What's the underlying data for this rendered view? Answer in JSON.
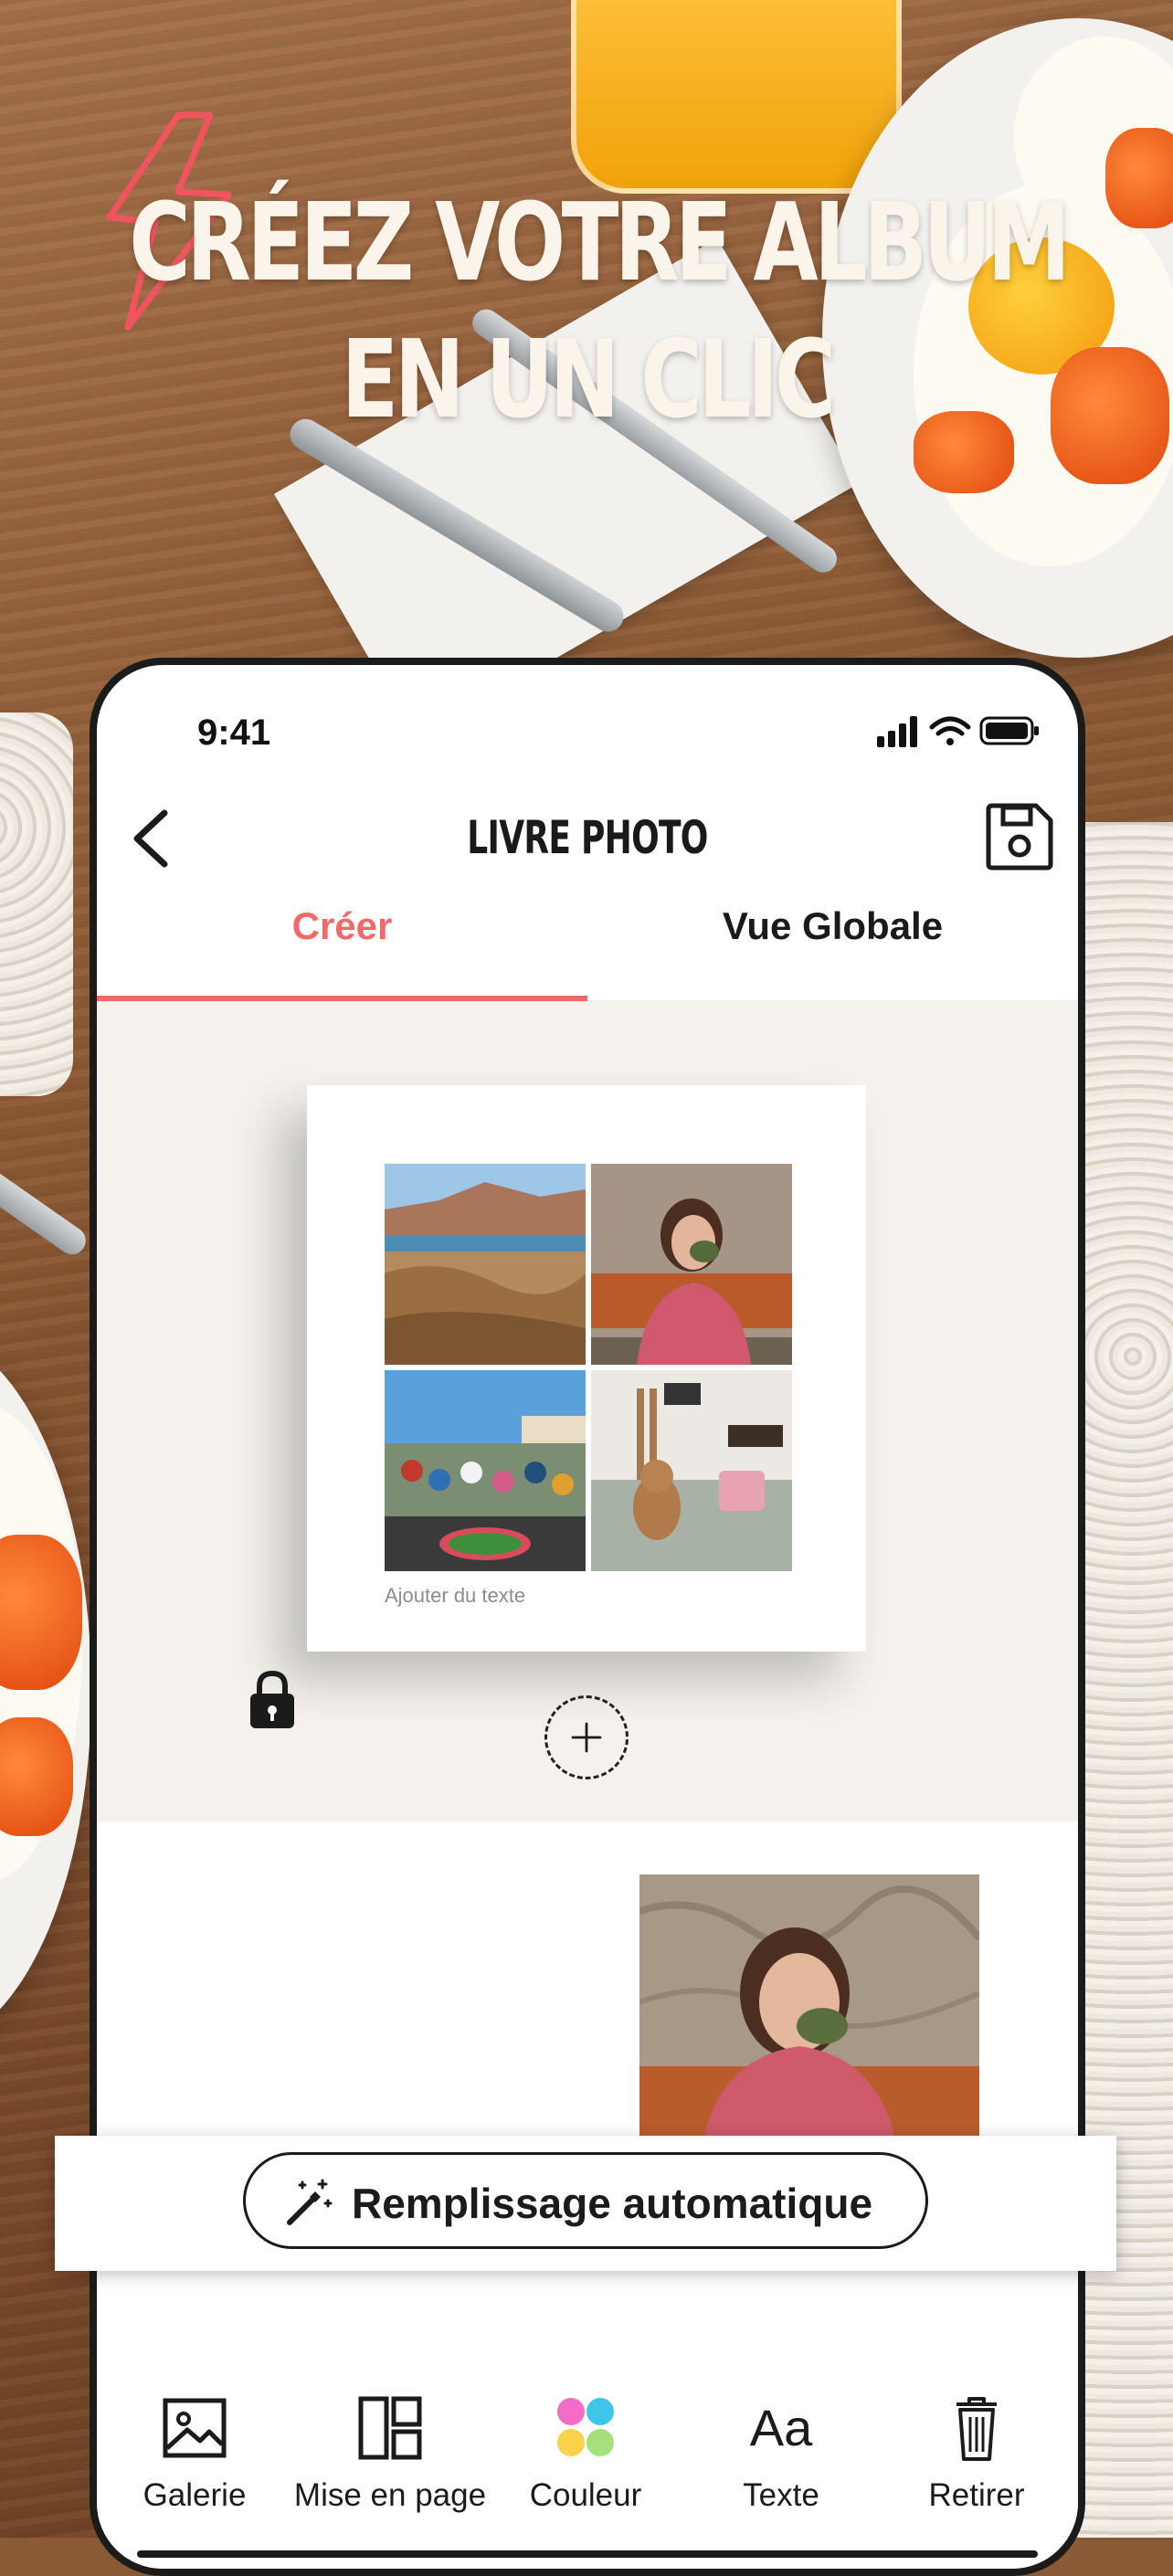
{
  "headline": {
    "line1": "CRÉEZ VOTRE ALBUM",
    "line2": "EN UN CLIC"
  },
  "status_bar": {
    "time": "9:41"
  },
  "nav": {
    "title": "LIVRE PHOTO"
  },
  "tabs": [
    {
      "label": "Créer",
      "active": true
    },
    {
      "label": "Vue Globale",
      "active": false
    }
  ],
  "album_page": {
    "caption_placeholder": "Ajouter du texte"
  },
  "auto_fill": {
    "label": "Remplissage automatique"
  },
  "toolbar": {
    "items": [
      {
        "label": "Galerie",
        "icon": "image-icon"
      },
      {
        "label": "Mise en page",
        "icon": "layout-icon"
      },
      {
        "label": "Couleur",
        "icon": "color-palette-icon"
      },
      {
        "label": "Texte",
        "icon": "text-icon",
        "glyph": "Aa"
      },
      {
        "label": "Retirer",
        "icon": "trash-icon"
      }
    ]
  },
  "colors": {
    "accent": "#f06a6a",
    "canvas_bg": "#f5f2ee",
    "text": "#1b1b1b"
  }
}
